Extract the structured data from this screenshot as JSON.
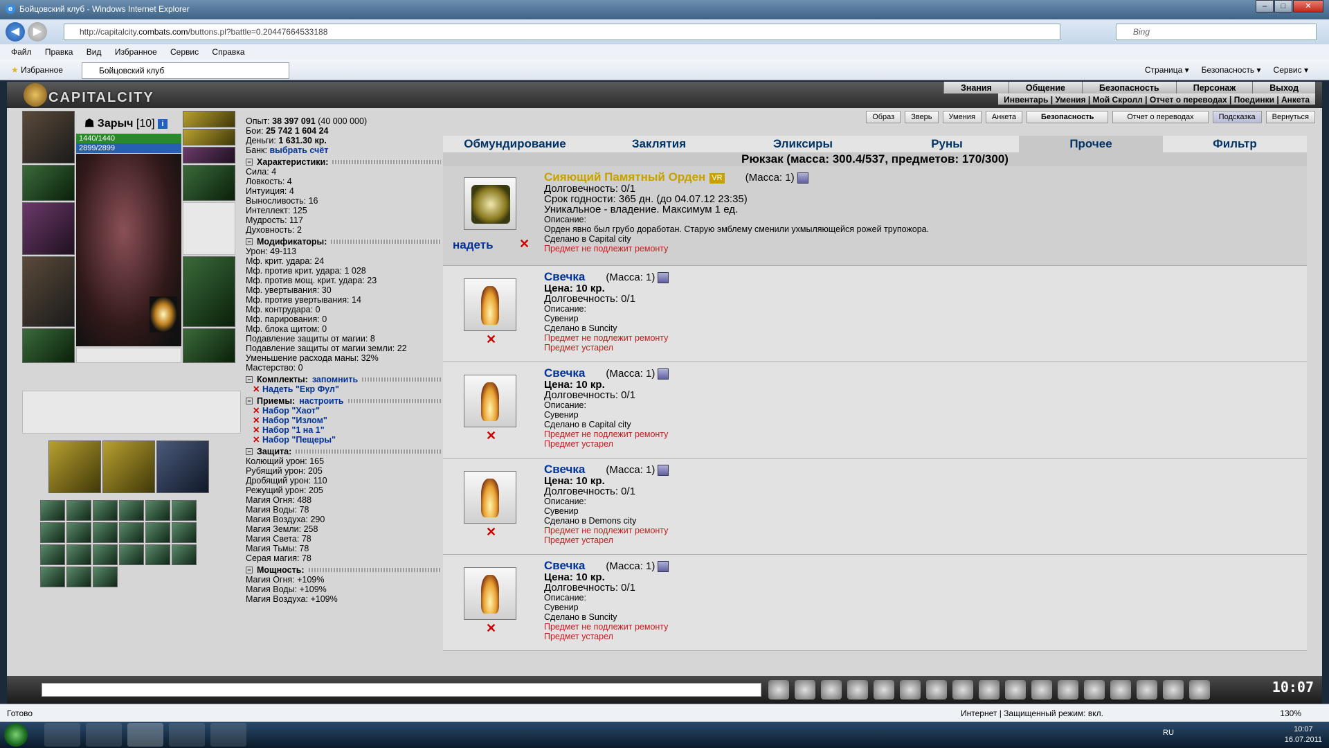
{
  "window": {
    "title": "Бойцовский клуб - Windows Internet Explorer"
  },
  "browser": {
    "url_prefix": "http://capitalcity.",
    "url_domain": "combats.com",
    "url_rest": "/buttons.pl?battle=0.20447664533188",
    "search_placeholder": "Bing",
    "menu": [
      "Файл",
      "Правка",
      "Вид",
      "Избранное",
      "Сервис",
      "Справка"
    ],
    "favorites_label": "Избранное",
    "tab_title": "Бойцовский клуб",
    "tools": [
      "Страница ▾",
      "Безопасность ▾",
      "Сервис ▾"
    ]
  },
  "game": {
    "brand": "CAPITALCITY",
    "topnav": [
      "Знания",
      "Общение",
      "Безопасность",
      "Персонаж",
      "Выход"
    ],
    "subnav": "Инвентарь | Умения | Мой Скролл | Отчет о переводах | Поединки | Анкета",
    "character": {
      "name": "Зарыч",
      "level": "[10]",
      "hp": "1440/1440",
      "mp": "2899/2899"
    },
    "stats": {
      "exp_label": "Опыт:",
      "exp_value": "38 397 091",
      "exp_next": "(40 000 000)",
      "battles_label": "Бои:",
      "battles_value": "25 742",
      "battles_lost": "1 604",
      "battles_draw": "24",
      "money_label": "Деньги:",
      "money_value": "1 631.30 кр.",
      "bank_label": "Банк:",
      "bank_link": "выбрать счёт",
      "char_header": "Характеристики:",
      "char_lines": [
        "Сила: 4",
        "Ловкость: 4",
        "Интуиция: 4",
        "Выносливость: 16",
        "Интеллект: 125",
        "Мудрость: 117",
        "Духовность: 2"
      ],
      "mod_header": "Модификаторы:",
      "mod_lines": [
        "Урон: 49-113",
        "Мф. крит. удара: 24",
        "Мф. против крит. удара: 1 028",
        "Мф. против мощ. крит. удара: 23",
        "Мф. увертывания: 30",
        "Мф. против увертывания: 14",
        "Мф. контрудара: 0",
        "Мф. парирования: 0",
        "Мф. блока щитом: 0",
        "Подавление защиты от магии: 8",
        "Подавление защиты от магии земли: 22",
        "Уменьшение расхода маны: 32%",
        "Мастерство: 0"
      ],
      "sets_header": "Комплекты:",
      "sets_link": "запомнить",
      "set_item": "Надеть \"Екр Фул\"",
      "tricks_header": "Приемы:",
      "tricks_link": "настроить",
      "tricks": [
        "Набор \"Хаот\"",
        "Набор \"Излом\"",
        "Набор \"1 на 1\"",
        "Набор \"Пещеры\""
      ],
      "def_header": "Защита:",
      "def_lines": [
        "Колющий урон: 165",
        "Рубящий урон: 205",
        "Дробящий урон: 110",
        "Режущий урон: 205",
        "Магия Огня: 488",
        "Магия Воды: 78",
        "Магия Воздуха: 290",
        "Магия Земли: 258",
        "Магия Света: 78",
        "Магия Тьмы: 78",
        "Серая магия: 78"
      ],
      "power_header": "Мощность:",
      "power_lines": [
        "Магия Огня: +109%",
        "Магия Воды: +109%",
        "Магия Воздуха: +109%"
      ]
    },
    "buttons": [
      "Образ",
      "Зверь",
      "Умения",
      "Анкета",
      "Безопасность",
      "Отчет о переводах",
      "Подсказка",
      "Вернуться"
    ],
    "tabs": [
      "Обмундирование",
      "Заклятия",
      "Эликсиры",
      "Руны",
      "Прочее",
      "Фильтр"
    ],
    "backpack": "Рюкзак (масса: 300.4/537, предметов: 170/300)",
    "items": [
      {
        "name": "Сияющий Памятный Орден",
        "badge": "VR",
        "mass": "(Масса: 1)",
        "wear": "надеть",
        "lines": [
          "Долговечность: 0/1",
          "Срок годности: 365 дн. (до 04.07.12 23:35)",
          "Уникальное - владение. Максимум 1 ед."
        ],
        "small": [
          "Описание:",
          "Орден явно был грубо доработан. Старую эмблему сменили ухмыляющейся рожей трупожора.",
          "Сделано в Capital city"
        ],
        "red": [
          "Предмет не подлежит ремонту"
        ]
      },
      {
        "name": "Свечка",
        "mass": "(Масса: 1)",
        "price": "Цена: 10 кр.",
        "lines": [
          "Долговечность: 0/1"
        ],
        "small": [
          "Описание:",
          "Сувенир",
          "Сделано в Suncity"
        ],
        "red": [
          "Предмет не подлежит ремонту",
          "Предмет устарел"
        ]
      },
      {
        "name": "Свечка",
        "mass": "(Масса: 1)",
        "price": "Цена: 10 кр.",
        "lines": [
          "Долговечность: 0/1"
        ],
        "small": [
          "Описание:",
          "Сувенир",
          "Сделано в Capital city"
        ],
        "red": [
          "Предмет не подлежит ремонту",
          "Предмет устарел"
        ]
      },
      {
        "name": "Свечка",
        "mass": "(Масса: 1)",
        "price": "Цена: 10 кр.",
        "lines": [
          "Долговечность: 0/1"
        ],
        "small": [
          "Описание:",
          "Сувенир",
          "Сделано в Demons city"
        ],
        "red": [
          "Предмет не подлежит ремонту",
          "Предмет устарел"
        ]
      },
      {
        "name": "Свечка",
        "mass": "(Масса: 1)",
        "price": "Цена: 10 кр.",
        "lines": [
          "Долговечность: 0/1"
        ],
        "small": [
          "Описание:",
          "Сувенир",
          "Сделано в Suncity"
        ],
        "red": [
          "Предмет не подлежит ремонту",
          "Предмет устарел"
        ]
      }
    ],
    "clock": "10:07"
  },
  "status": {
    "left": "Готово",
    "zone": "Интернет | Защищенный режим: вкл.",
    "zoom": "130%"
  },
  "taskbar": {
    "lang": "RU",
    "time": "10:07",
    "date": "16.07.2011"
  }
}
